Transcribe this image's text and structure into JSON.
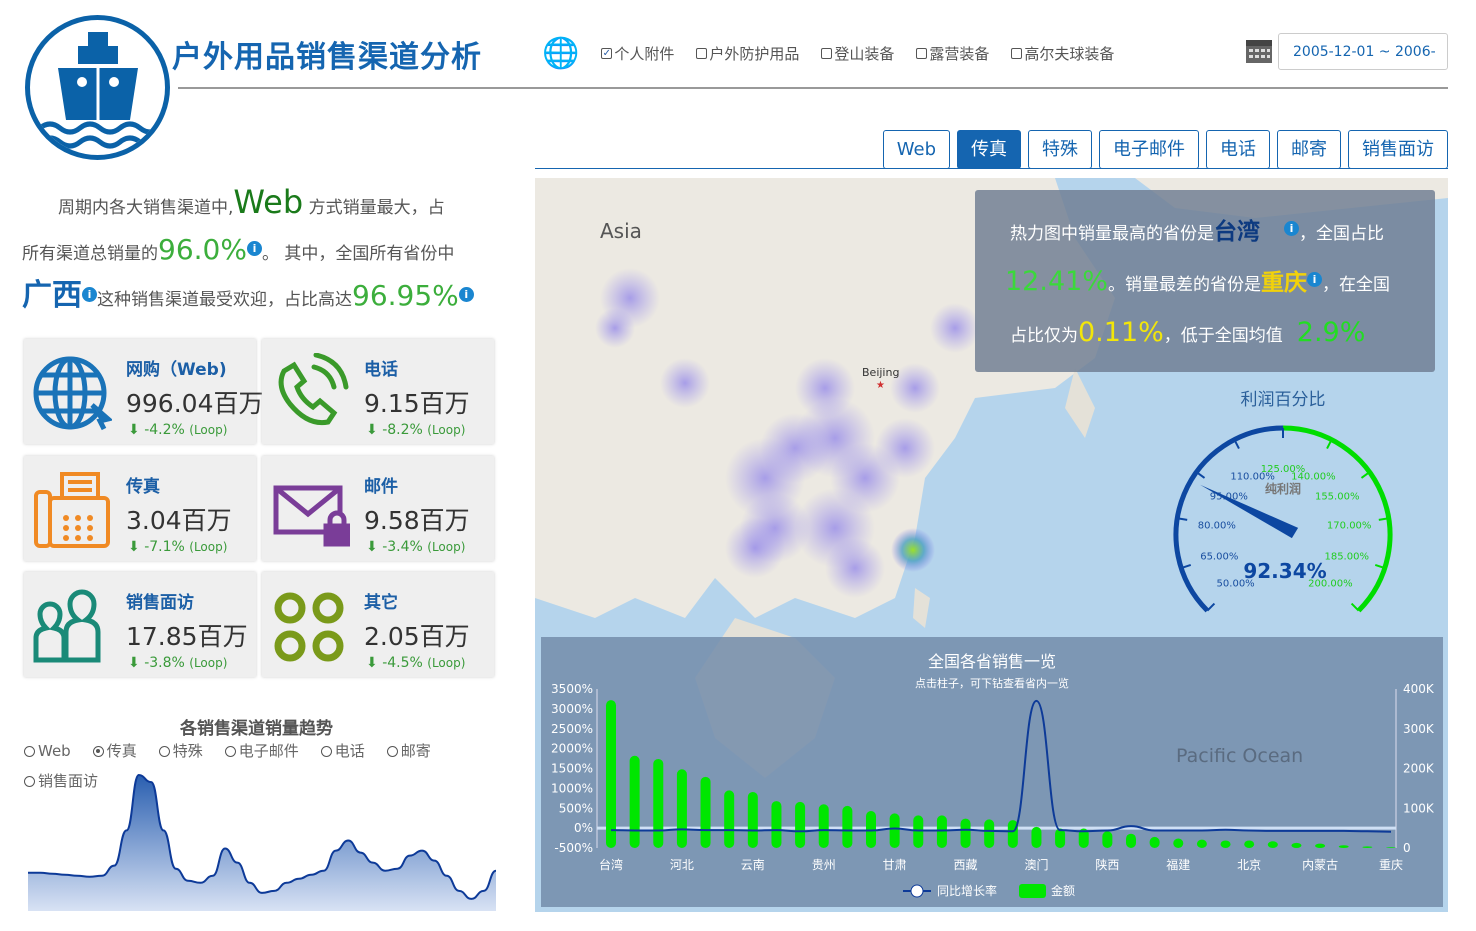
{
  "header": {
    "title": "户外用品销售渠道分析",
    "date_range": "2005-12-01 ~ 2006-",
    "categories": [
      {
        "label": "个人附件",
        "checked": true
      },
      {
        "label": "户外防护用品",
        "checked": false
      },
      {
        "label": "登山装备",
        "checked": false
      },
      {
        "label": "露营装备",
        "checked": false
      },
      {
        "label": "高尔夫球装备",
        "checked": false
      }
    ]
  },
  "tabs": [
    {
      "label": "Web",
      "active": false
    },
    {
      "label": "传真",
      "active": true
    },
    {
      "label": "特殊",
      "active": false
    },
    {
      "label": "电子邮件",
      "active": false
    },
    {
      "label": "电话",
      "active": false
    },
    {
      "label": "邮寄",
      "active": false
    },
    {
      "label": "销售面访",
      "active": false
    }
  ],
  "summary": {
    "t1": "周期内各大销售渠道中,",
    "top_channel": "Web",
    "t2": " 方式销量最大，占",
    "t3": "所有渠道总销量的",
    "top_share": "96.0%",
    "t4": "。 其中，全国所有省份中",
    "top_province": "广西",
    "t5": "这种销售渠道最受欢迎，占比高达",
    "province_share": "96.95%"
  },
  "cards": [
    {
      "name": "网购（Web)",
      "value": "996.04百万",
      "change": "-4.2%",
      "suffix": "(Loop)",
      "icon": "globe-icon",
      "color": "#1a73b8"
    },
    {
      "name": "电话",
      "value": "9.15百万",
      "change": "-8.2%",
      "suffix": "(Loop)",
      "icon": "phone-icon",
      "color": "#3a9a2a"
    },
    {
      "name": "传真",
      "value": "3.04百万",
      "change": "-7.1%",
      "suffix": "(Loop)",
      "icon": "fax-icon",
      "color": "#f08a24"
    },
    {
      "name": "邮件",
      "value": "9.58百万",
      "change": "-3.4%",
      "suffix": "(Loop)",
      "icon": "mail-lock-icon",
      "color": "#7a3d98"
    },
    {
      "name": "销售面访",
      "value": "17.85百万",
      "change": "-3.8%",
      "suffix": "(Loop)",
      "icon": "people-icon",
      "color": "#1a8a78"
    },
    {
      "name": "其它",
      "value": "2.05百万",
      "change": "-4.5%",
      "suffix": "(Loop)",
      "icon": "circles-icon",
      "color": "#7a9a1a"
    }
  ],
  "trend": {
    "title": "各销售渠道销量趋势",
    "options": [
      {
        "label": "Web",
        "on": false
      },
      {
        "label": "传真",
        "on": true
      },
      {
        "label": "特殊",
        "on": false
      },
      {
        "label": "电子邮件",
        "on": false
      },
      {
        "label": "电话",
        "on": false
      },
      {
        "label": "邮寄",
        "on": false
      },
      {
        "label": "销售面访",
        "on": false
      }
    ],
    "chart_data": {
      "type": "area",
      "values": [
        38,
        38,
        37,
        36,
        35,
        34,
        35,
        45,
        80,
        135,
        128,
        80,
        42,
        30,
        28,
        35,
        62,
        48,
        28,
        18,
        20,
        28,
        32,
        36,
        40,
        60,
        70,
        58,
        48,
        40,
        42,
        55,
        60,
        50,
        35,
        20,
        12,
        20,
        40
      ]
    }
  },
  "map": {
    "label_asia": "Asia",
    "label_beijing": "Beijing",
    "label_ocean": "Pacific Ocean"
  },
  "infobox": {
    "t1": "热力图中销量最高的省份是",
    "top": "台湾",
    "t2": "，全国占比",
    "top_share": "12.41%",
    "t3": "。销量最差的省份是",
    "worst": "重庆",
    "t4": "，在全国",
    "t5": "占比仅为",
    "worst_share": "0.11%",
    "t6": "，低于全国均值",
    "avg": "2.9%"
  },
  "gauge": {
    "title": "利润百分比",
    "label": "纯利润",
    "value": 92.34,
    "value_text": "92.34%",
    "min": 50,
    "max": 200,
    "split": 125,
    "ticks": [
      "50.00%",
      "65.00%",
      "80.00%",
      "95.00%",
      "110.00%",
      "125.00%",
      "140.00%",
      "155.00%",
      "170.00%",
      "185.00%",
      "200.00%"
    ],
    "colors": {
      "low": "#0d47a1",
      "high": "#00dd00"
    }
  },
  "chart_data": {
    "type": "bar",
    "title": "全国各省销售一览",
    "subtitle": "点击柱子，可下钻查看省内一览",
    "categories": [
      "台湾",
      "",
      "",
      "河北",
      "",
      "",
      "云南",
      "",
      "",
      "贵州",
      "",
      "",
      "甘肃",
      "",
      "",
      "西藏",
      "",
      "",
      "澳门",
      "",
      "",
      "陕西",
      "",
      "",
      "福建",
      "",
      "",
      "北京",
      "",
      "",
      "内蒙古",
      "",
      "",
      "重庆"
    ],
    "series": [
      {
        "name": "金额",
        "type": "bar",
        "axis": "right",
        "values": [
          372,
          232,
          224,
          198,
          179,
          145,
          141,
          118,
          116,
          110,
          106,
          93,
          87,
          82,
          82,
          74,
          72,
          70,
          53,
          49,
          49,
          42,
          36,
          28,
          24,
          21,
          19,
          19,
          17,
          13,
          11,
          7,
          4,
          2
        ]
      },
      {
        "name": "同比增长率",
        "type": "line",
        "axis": "left",
        "values": [
          -50,
          -60,
          -60,
          -30,
          -50,
          -50,
          -60,
          -50,
          -80,
          -50,
          -60,
          -60,
          -10,
          -60,
          -60,
          -40,
          -70,
          -80,
          3200,
          -50,
          -80,
          -60,
          50,
          -60,
          -60,
          -60,
          -40,
          -60,
          -70,
          -70,
          -70,
          -70,
          -80,
          -90
        ]
      }
    ],
    "ylim_left": [
      -500,
      3500
    ],
    "yticks_left": [
      "3500%",
      "3000%",
      "2500%",
      "2000%",
      "1500%",
      "1000%",
      "500%",
      "0%",
      "-500%"
    ],
    "ylim_right": [
      0,
      400
    ],
    "yticks_right": [
      "400K",
      "300K",
      "200K",
      "100K",
      "0"
    ],
    "legend": [
      "同比增长率",
      "金额"
    ]
  }
}
